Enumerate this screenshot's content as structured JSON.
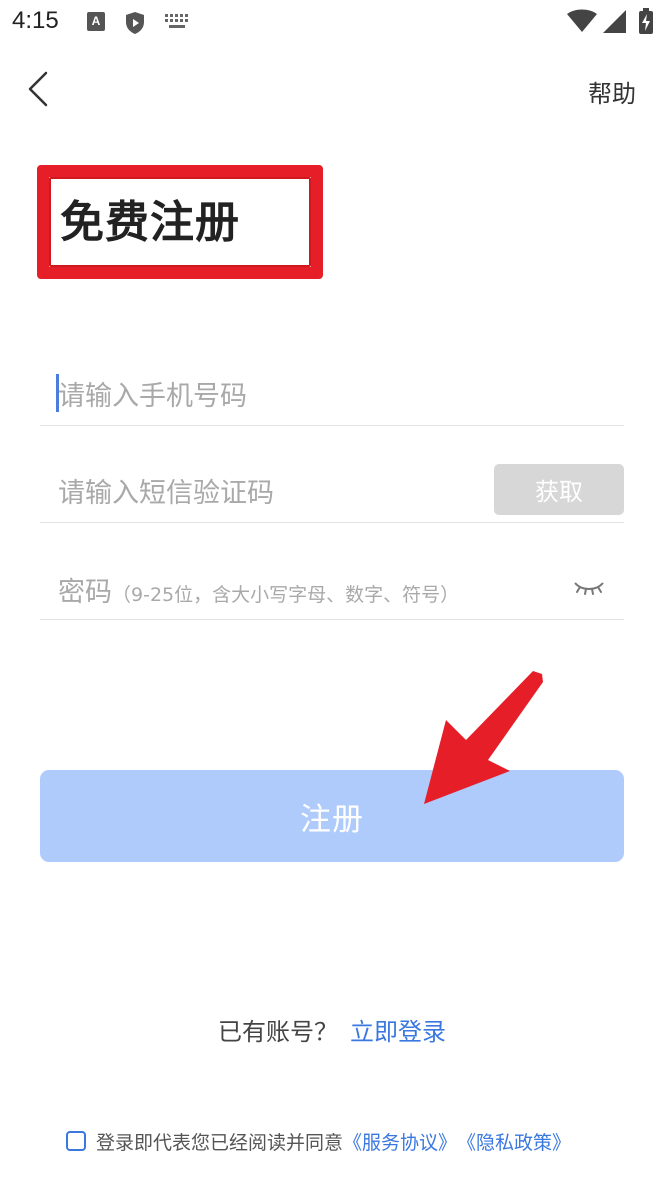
{
  "status_bar": {
    "time": "4:15",
    "a_badge": "A",
    "icons": [
      "a-notification-icon",
      "shield-icon",
      "keyboard-icon",
      "wifi-icon",
      "signal-icon",
      "battery-charging-icon"
    ]
  },
  "header": {
    "back_icon": "chevron-left-icon",
    "help_label": "帮助"
  },
  "title": "免费注册",
  "form": {
    "phone_placeholder": "请输入手机号码",
    "sms_placeholder": "请输入短信验证码",
    "get_code_label": "获取",
    "password_label": "密码",
    "password_hint": "（9-25位，含大小写字母、数字、符号）",
    "eye_icon": "eye-closed-icon"
  },
  "register_label": "注册",
  "login_prompt": {
    "text": "已有账号？",
    "link": "立即登录"
  },
  "agreement": {
    "text": "登录即代表您已经阅读并同意",
    "service_link": "《服务协议》",
    "privacy_link": "《隐私政策》",
    "checked": false
  },
  "colors": {
    "accent": "#3a78e0",
    "register_button": "#afcbfb",
    "get_code_button": "#d7d7d7",
    "annotation_red": "#e61e28"
  }
}
